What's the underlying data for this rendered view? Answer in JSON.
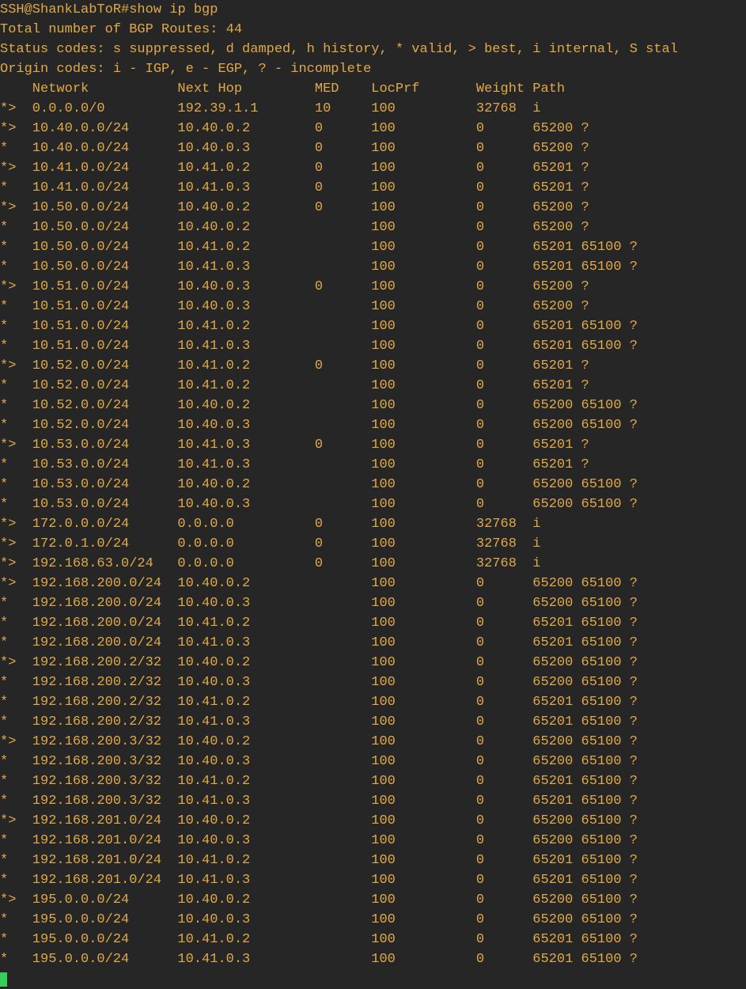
{
  "prompt": "SSH@ShankLabToR#",
  "command": "show ip bgp",
  "total_line": "Total number of BGP Routes: 44",
  "status_line": "Status codes: s suppressed, d damped, h history, * valid, > best, i internal, S stal",
  "origin_line": "Origin codes: i - IGP, e - EGP, ? - incomplete",
  "columns": {
    "status": {
      "label": "",
      "width": 4
    },
    "network": {
      "label": "Network",
      "width": 18
    },
    "nexthop": {
      "label": "Next Hop",
      "width": 17
    },
    "med": {
      "label": "MED",
      "width": 7
    },
    "locprf": {
      "label": "LocPrf",
      "width": 13
    },
    "weight": {
      "label": "Weight",
      "width": 7
    },
    "path": {
      "label": "Path",
      "width": 0
    }
  },
  "routes": [
    {
      "status": "*>",
      "network": "0.0.0.0/0",
      "nexthop": "192.39.1.1",
      "med": "10",
      "locprf": "100",
      "weight": "32768",
      "path": "i"
    },
    {
      "status": "*>",
      "network": "10.40.0.0/24",
      "nexthop": "10.40.0.2",
      "med": "0",
      "locprf": "100",
      "weight": "0",
      "path": "65200 ?"
    },
    {
      "status": "*",
      "network": "10.40.0.0/24",
      "nexthop": "10.40.0.3",
      "med": "0",
      "locprf": "100",
      "weight": "0",
      "path": "65200 ?"
    },
    {
      "status": "*>",
      "network": "10.41.0.0/24",
      "nexthop": "10.41.0.2",
      "med": "0",
      "locprf": "100",
      "weight": "0",
      "path": "65201 ?"
    },
    {
      "status": "*",
      "network": "10.41.0.0/24",
      "nexthop": "10.41.0.3",
      "med": "0",
      "locprf": "100",
      "weight": "0",
      "path": "65201 ?"
    },
    {
      "status": "*>",
      "network": "10.50.0.0/24",
      "nexthop": "10.40.0.2",
      "med": "0",
      "locprf": "100",
      "weight": "0",
      "path": "65200 ?"
    },
    {
      "status": "*",
      "network": "10.50.0.0/24",
      "nexthop": "10.40.0.2",
      "med": "",
      "locprf": "100",
      "weight": "0",
      "path": "65200 ?"
    },
    {
      "status": "*",
      "network": "10.50.0.0/24",
      "nexthop": "10.41.0.2",
      "med": "",
      "locprf": "100",
      "weight": "0",
      "path": "65201 65100 ?"
    },
    {
      "status": "*",
      "network": "10.50.0.0/24",
      "nexthop": "10.41.0.3",
      "med": "",
      "locprf": "100",
      "weight": "0",
      "path": "65201 65100 ?"
    },
    {
      "status": "*>",
      "network": "10.51.0.0/24",
      "nexthop": "10.40.0.3",
      "med": "0",
      "locprf": "100",
      "weight": "0",
      "path": "65200 ?"
    },
    {
      "status": "*",
      "network": "10.51.0.0/24",
      "nexthop": "10.40.0.3",
      "med": "",
      "locprf": "100",
      "weight": "0",
      "path": "65200 ?"
    },
    {
      "status": "*",
      "network": "10.51.0.0/24",
      "nexthop": "10.41.0.2",
      "med": "",
      "locprf": "100",
      "weight": "0",
      "path": "65201 65100 ?"
    },
    {
      "status": "*",
      "network": "10.51.0.0/24",
      "nexthop": "10.41.0.3",
      "med": "",
      "locprf": "100",
      "weight": "0",
      "path": "65201 65100 ?"
    },
    {
      "status": "*>",
      "network": "10.52.0.0/24",
      "nexthop": "10.41.0.2",
      "med": "0",
      "locprf": "100",
      "weight": "0",
      "path": "65201 ?"
    },
    {
      "status": "*",
      "network": "10.52.0.0/24",
      "nexthop": "10.41.0.2",
      "med": "",
      "locprf": "100",
      "weight": "0",
      "path": "65201 ?"
    },
    {
      "status": "*",
      "network": "10.52.0.0/24",
      "nexthop": "10.40.0.2",
      "med": "",
      "locprf": "100",
      "weight": "0",
      "path": "65200 65100 ?"
    },
    {
      "status": "*",
      "network": "10.52.0.0/24",
      "nexthop": "10.40.0.3",
      "med": "",
      "locprf": "100",
      "weight": "0",
      "path": "65200 65100 ?"
    },
    {
      "status": "*>",
      "network": "10.53.0.0/24",
      "nexthop": "10.41.0.3",
      "med": "0",
      "locprf": "100",
      "weight": "0",
      "path": "65201 ?"
    },
    {
      "status": "*",
      "network": "10.53.0.0/24",
      "nexthop": "10.41.0.3",
      "med": "",
      "locprf": "100",
      "weight": "0",
      "path": "65201 ?"
    },
    {
      "status": "*",
      "network": "10.53.0.0/24",
      "nexthop": "10.40.0.2",
      "med": "",
      "locprf": "100",
      "weight": "0",
      "path": "65200 65100 ?"
    },
    {
      "status": "*",
      "network": "10.53.0.0/24",
      "nexthop": "10.40.0.3",
      "med": "",
      "locprf": "100",
      "weight": "0",
      "path": "65200 65100 ?"
    },
    {
      "status": "*>",
      "network": "172.0.0.0/24",
      "nexthop": "0.0.0.0",
      "med": "0",
      "locprf": "100",
      "weight": "32768",
      "path": "i"
    },
    {
      "status": "*>",
      "network": "172.0.1.0/24",
      "nexthop": "0.0.0.0",
      "med": "0",
      "locprf": "100",
      "weight": "32768",
      "path": "i"
    },
    {
      "status": "*>",
      "network": "192.168.63.0/24",
      "nexthop": "0.0.0.0",
      "med": "0",
      "locprf": "100",
      "weight": "32768",
      "path": "i"
    },
    {
      "status": "*>",
      "network": "192.168.200.0/24",
      "nexthop": "10.40.0.2",
      "med": "",
      "locprf": "100",
      "weight": "0",
      "path": "65200 65100 ?"
    },
    {
      "status": "*",
      "network": "192.168.200.0/24",
      "nexthop": "10.40.0.3",
      "med": "",
      "locprf": "100",
      "weight": "0",
      "path": "65200 65100 ?"
    },
    {
      "status": "*",
      "network": "192.168.200.0/24",
      "nexthop": "10.41.0.2",
      "med": "",
      "locprf": "100",
      "weight": "0",
      "path": "65201 65100 ?"
    },
    {
      "status": "*",
      "network": "192.168.200.0/24",
      "nexthop": "10.41.0.3",
      "med": "",
      "locprf": "100",
      "weight": "0",
      "path": "65201 65100 ?"
    },
    {
      "status": "*>",
      "network": "192.168.200.2/32",
      "nexthop": "10.40.0.2",
      "med": "",
      "locprf": "100",
      "weight": "0",
      "path": "65200 65100 ?"
    },
    {
      "status": "*",
      "network": "192.168.200.2/32",
      "nexthop": "10.40.0.3",
      "med": "",
      "locprf": "100",
      "weight": "0",
      "path": "65200 65100 ?"
    },
    {
      "status": "*",
      "network": "192.168.200.2/32",
      "nexthop": "10.41.0.2",
      "med": "",
      "locprf": "100",
      "weight": "0",
      "path": "65201 65100 ?"
    },
    {
      "status": "*",
      "network": "192.168.200.2/32",
      "nexthop": "10.41.0.3",
      "med": "",
      "locprf": "100",
      "weight": "0",
      "path": "65201 65100 ?"
    },
    {
      "status": "*>",
      "network": "192.168.200.3/32",
      "nexthop": "10.40.0.2",
      "med": "",
      "locprf": "100",
      "weight": "0",
      "path": "65200 65100 ?"
    },
    {
      "status": "*",
      "network": "192.168.200.3/32",
      "nexthop": "10.40.0.3",
      "med": "",
      "locprf": "100",
      "weight": "0",
      "path": "65200 65100 ?"
    },
    {
      "status": "*",
      "network": "192.168.200.3/32",
      "nexthop": "10.41.0.2",
      "med": "",
      "locprf": "100",
      "weight": "0",
      "path": "65201 65100 ?"
    },
    {
      "status": "*",
      "network": "192.168.200.3/32",
      "nexthop": "10.41.0.3",
      "med": "",
      "locprf": "100",
      "weight": "0",
      "path": "65201 65100 ?"
    },
    {
      "status": "*>",
      "network": "192.168.201.0/24",
      "nexthop": "10.40.0.2",
      "med": "",
      "locprf": "100",
      "weight": "0",
      "path": "65200 65100 ?"
    },
    {
      "status": "*",
      "network": "192.168.201.0/24",
      "nexthop": "10.40.0.3",
      "med": "",
      "locprf": "100",
      "weight": "0",
      "path": "65200 65100 ?"
    },
    {
      "status": "*",
      "network": "192.168.201.0/24",
      "nexthop": "10.41.0.2",
      "med": "",
      "locprf": "100",
      "weight": "0",
      "path": "65201 65100 ?"
    },
    {
      "status": "*",
      "network": "192.168.201.0/24",
      "nexthop": "10.41.0.3",
      "med": "",
      "locprf": "100",
      "weight": "0",
      "path": "65201 65100 ?"
    },
    {
      "status": "*>",
      "network": "195.0.0.0/24",
      "nexthop": "10.40.0.2",
      "med": "",
      "locprf": "100",
      "weight": "0",
      "path": "65200 65100 ?"
    },
    {
      "status": "*",
      "network": "195.0.0.0/24",
      "nexthop": "10.40.0.3",
      "med": "",
      "locprf": "100",
      "weight": "0",
      "path": "65200 65100 ?"
    },
    {
      "status": "*",
      "network": "195.0.0.0/24",
      "nexthop": "10.41.0.2",
      "med": "",
      "locprf": "100",
      "weight": "0",
      "path": "65201 65100 ?"
    },
    {
      "status": "*",
      "network": "195.0.0.0/24",
      "nexthop": "10.41.0.3",
      "med": "",
      "locprf": "100",
      "weight": "0",
      "path": "65201 65100 ?"
    }
  ]
}
